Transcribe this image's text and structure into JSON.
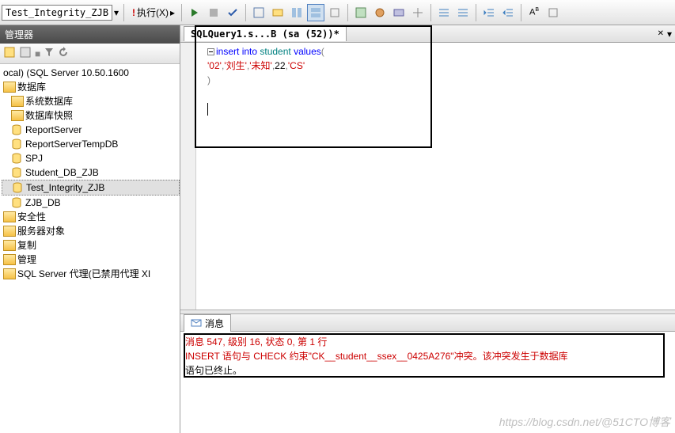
{
  "toolbar": {
    "db_input": "Test_Integrity_ZJB",
    "execute_label": "执行(X)"
  },
  "sidebar": {
    "title": "管理器",
    "server": "ocal) (SQL Server 10.50.1600",
    "root": "数据库",
    "items": [
      {
        "label": "系统数据库",
        "icon": "folder"
      },
      {
        "label": "数据库快照",
        "icon": "folder"
      },
      {
        "label": "ReportServer",
        "icon": "db"
      },
      {
        "label": "ReportServerTempDB",
        "icon": "db"
      },
      {
        "label": "SPJ",
        "icon": "db"
      },
      {
        "label": "Student_DB_ZJB",
        "icon": "db"
      },
      {
        "label": "Test_Integrity_ZJB",
        "icon": "db",
        "sel": true
      },
      {
        "label": "ZJB_DB",
        "icon": "db"
      }
    ],
    "nodes": [
      "安全性",
      "服务器对象",
      "复制",
      "管理",
      "SQL Server 代理(已禁用代理 XI"
    ]
  },
  "query_tab": "SQLQuery1.s...B (sa (52))*",
  "code": {
    "l1_kw1": "insert ",
    "l1_kw2": "into ",
    "l1_id": "student ",
    "l1_kw3": "values",
    "l1_p": "(",
    "l2_s1": "'02'",
    "l2_c1": ",",
    "l2_s2": "'刘生'",
    "l2_c2": ",",
    "l2_s3": "'未知'",
    "l2_c3": ",",
    "l2_n": "22",
    "l2_c4": ",",
    "l2_s4": "'CS'",
    "l3_p": ")"
  },
  "messages": {
    "tab": "消息",
    "line1": "消息 547, 级别 16, 状态 0, 第 1 行",
    "line2a": "INSERT 语句与 CHECK 约束\"CK__student__ssex__0425A276\"冲突。",
    "line2b": "该冲突发生于数据库",
    "line3": "语句已终止。"
  },
  "watermark": "https://blog.csdn.net/@51CTO博客"
}
